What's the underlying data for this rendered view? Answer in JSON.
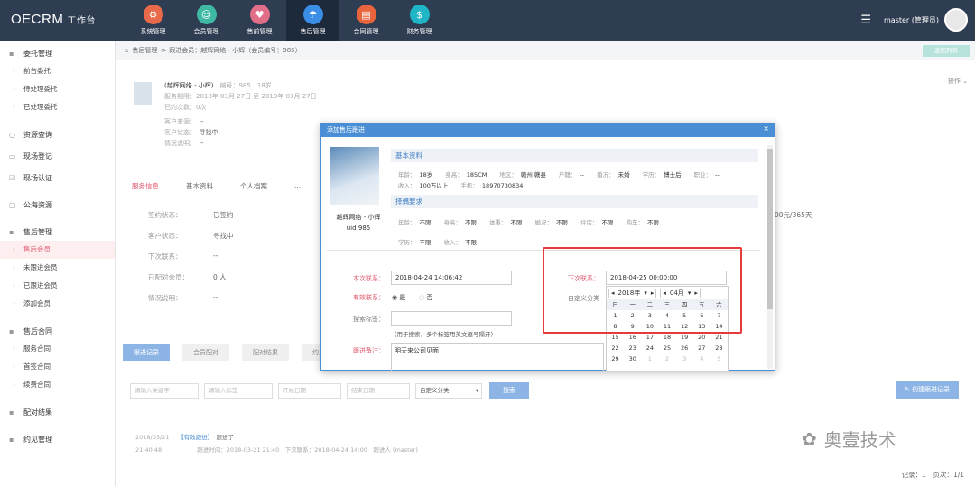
{
  "app": {
    "logo": "OECRM",
    "logo_sub": "工作台"
  },
  "nav": [
    {
      "label": "系统管理",
      "color": "#e86a4a",
      "icon": "gear-icon",
      "glyph": "⚙"
    },
    {
      "label": "会员管理",
      "color": "#3fb8a4",
      "icon": "user-icon",
      "glyph": "☺"
    },
    {
      "label": "售前管理",
      "color": "#e26f8a",
      "icon": "heart-icon",
      "glyph": "♥"
    },
    {
      "label": "售后管理",
      "color": "#3a8ee6",
      "icon": "umbrella-icon",
      "glyph": "☂"
    },
    {
      "label": "合同管理",
      "color": "#e8643c",
      "icon": "contract-icon",
      "glyph": "▤"
    },
    {
      "label": "财务管理",
      "color": "#1fb5c6",
      "icon": "finance-icon",
      "glyph": "$"
    }
  ],
  "user": {
    "name": "master (管理员)"
  },
  "sidebar": [
    {
      "group": "委托管理",
      "icon": "delegate-icon",
      "items": [
        "前台委托",
        "待处理委托",
        "已处理委托"
      ]
    },
    {
      "group": "",
      "icon": "",
      "items": []
    },
    {
      "single": [
        {
          "label": "资源查询",
          "icon": "search-icon",
          "g": "○"
        },
        {
          "label": "现场登记",
          "icon": "register-icon",
          "g": "▭"
        },
        {
          "label": "现场认证",
          "icon": "check-icon",
          "g": "☑"
        }
      ]
    },
    {
      "single": [
        {
          "label": "公海资源",
          "icon": "pool-icon",
          "g": "▢"
        }
      ]
    },
    {
      "group": "售后管理",
      "icon": "aftersale-icon",
      "items": [
        "售后会员",
        "未跟进会员",
        "已跟进会员",
        "添加会员"
      ]
    },
    {
      "group": "售后合同",
      "icon": "contract-icon",
      "items": [
        "服务合同",
        "首签合同",
        "续费合同"
      ]
    },
    {
      "group": "配对结果",
      "icon": "match-icon",
      "items": []
    },
    {
      "group": "约见管理",
      "icon": "meet-icon",
      "items": []
    }
  ],
  "crumb": "售后管理 -> 跟进会员：越辉网络 - 小辉（会员编号：985）",
  "back_label": "返回列表",
  "ops_label": "操作",
  "profile": {
    "name": "(越辉网络 - 小辉)",
    "num": "编号：985　18岁",
    "period": "服务期限：2018年 03月 27日 至 2019年 03月 27日",
    "visits": "已约次数：0次",
    "src_lbl": "客户来源：",
    "src": "--",
    "status_lbl": "客户状态：",
    "status": "寻找中",
    "info_lbl": "情况说明：",
    "info": "--"
  },
  "tabs": [
    "服务信息",
    "基本资料",
    "个人档案",
    "..."
  ],
  "left_fields": [
    {
      "label": "签约状态：",
      "value": "已签约"
    },
    {
      "label": "客户状态：",
      "value": "寻找中"
    },
    {
      "label": "下次联系：",
      "value": "--"
    },
    {
      "label": "已配对会员：",
      "value": "0 人"
    },
    {
      "label": "情况说明：",
      "value": "--"
    }
  ],
  "right_partial": "00元/365天",
  "buttons": [
    "跟进记录",
    "会员配对",
    "配对结果",
    "约见..."
  ],
  "filters": [
    "请输入关键字",
    "请输入标签",
    "开始日期",
    "结束日期"
  ],
  "filter_select": "自定义分类",
  "search_label": "搜索",
  "new_label": "创建跟进记录",
  "record": {
    "date": "2018/03/21",
    "time": "21:40:48",
    "tag": "【有效跟进】",
    "text": "跟进了",
    "meta": "跟进时间：2018-03-21 21:40　下次联系：2018-04-24 14:00　跟进人 (master)"
  },
  "footer": "记录：1　页次：1/1",
  "watermark": "奥壹技术",
  "modal": {
    "title": "添加售后跟进",
    "member_name": "越辉网络 - 小辉",
    "uid": "uid:985",
    "sec1": "基本资料",
    "sec2": "择偶要求",
    "basic1": [
      [
        "年龄：",
        "18岁"
      ],
      [
        "身高：",
        "185CM"
      ],
      [
        "地区：",
        "赣州 赣县"
      ],
      [
        "户籍：",
        "--"
      ],
      [
        "婚况：",
        "未婚"
      ],
      [
        "学历：",
        "博士后"
      ],
      [
        "职业：",
        "--"
      ]
    ],
    "basic2": [
      [
        "收入：",
        "100万以上"
      ],
      [
        "手机：",
        "18970730834"
      ]
    ],
    "req1": [
      [
        "年龄：",
        "不限"
      ],
      [
        "身高：",
        "不限"
      ],
      [
        "体重：",
        "不限"
      ],
      [
        "婚况：",
        "不限"
      ],
      [
        "住房：",
        "不限"
      ],
      [
        "购车：",
        "不限"
      ]
    ],
    "req2": [
      [
        "学历：",
        "不限"
      ],
      [
        "收入：",
        "不限"
      ]
    ],
    "this_contact_lbl": "本次联系：",
    "this_contact": "2018-04-24 14:06:42",
    "valid_lbl": "有效联系：",
    "yes": "是",
    "no": "否",
    "tag_lbl": "搜索标签：",
    "tag_hint": "（用于搜索，多个标签用英文逗号隔开）",
    "note_lbl": "跟进备注：",
    "note": "明天来公司见面",
    "next_lbl": "下次联系：",
    "next": "2018-04-25 00:00:00",
    "cat_lbl": "自定义分类"
  },
  "calendar": {
    "year": "2018年",
    "month": "04月",
    "weekdays": [
      "日",
      "一",
      "二",
      "三",
      "四",
      "五",
      "六"
    ],
    "days": [
      [
        "1",
        "2",
        "3",
        "4",
        "5",
        "6",
        "7"
      ],
      [
        "8",
        "9",
        "10",
        "11",
        "12",
        "13",
        "14"
      ],
      [
        "15",
        "16",
        "17",
        "18",
        "19",
        "20",
        "21"
      ],
      [
        "22",
        "23",
        "24",
        "25",
        "26",
        "27",
        "28"
      ],
      [
        "29",
        "30",
        "1",
        "2",
        "3",
        "4",
        "5"
      ]
    ]
  }
}
